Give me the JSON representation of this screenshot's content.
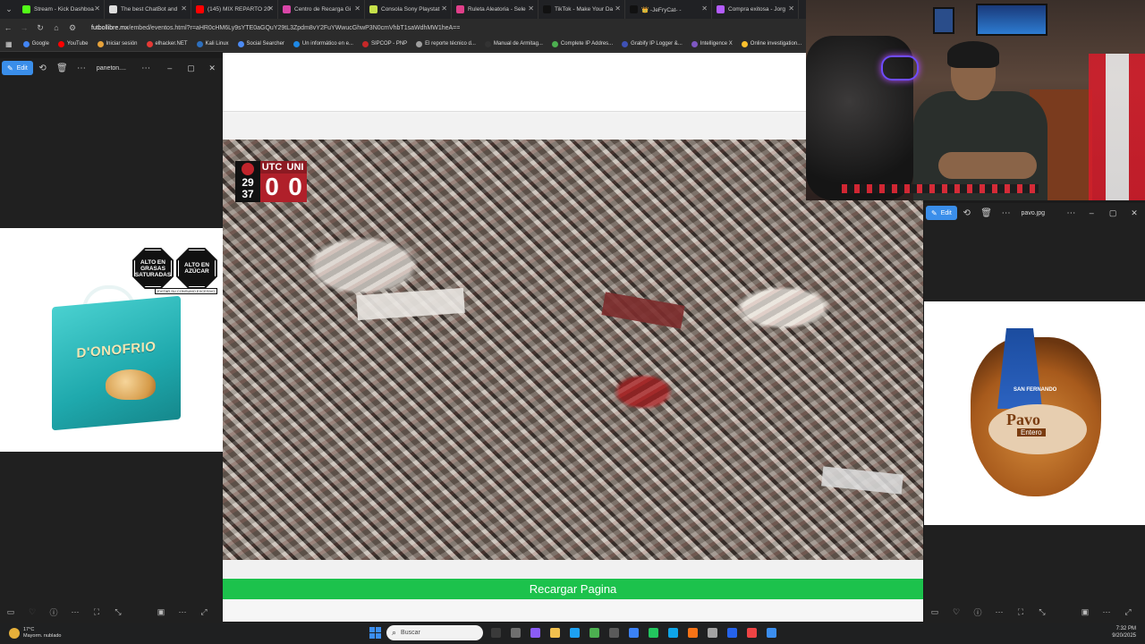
{
  "browser": {
    "tabs": [
      {
        "label": "Stream - Kick Dashboa",
        "color": "#53fc18"
      },
      {
        "label": "The best ChatBot and",
        "color": "#dddddd"
      },
      {
        "label": "(145) MIX REPARTO 20",
        "color": "#ff0000"
      },
      {
        "label": "Centro de Recarga Gi",
        "color": "#d946a8"
      },
      {
        "label": "Consola Sony Playstat",
        "color": "#c6e14a"
      },
      {
        "label": "Ruleta Aleatoria - Sele",
        "color": "#e03f8a"
      },
      {
        "label": "TikTok - Make Your Da",
        "color": "#111111"
      },
      {
        "label": "👑 -JeFryCat- -",
        "color": "#111111"
      },
      {
        "label": "Compra exitosa - Jorg",
        "color": "#b45cff"
      }
    ],
    "url_host": "futbollibre.mx",
    "url_path": "/embed/eventos.html?r=aHR0cHM6Ly9sYTE0aGQuY29tL3Zpdm8vY2FuYWwucGhwP3N0cmVhbT1saWdhMW1heA==",
    "bookmarks": [
      {
        "label": "Google",
        "color": "#4285f4"
      },
      {
        "label": "YouTube",
        "color": "#ff0000"
      },
      {
        "label": "Iniciar sesión",
        "color": "#e6a23a"
      },
      {
        "label": "elhacker.NET",
        "color": "#e53935"
      },
      {
        "label": "Kali Linux",
        "color": "#2d6fbe"
      },
      {
        "label": "Social Searcher",
        "color": "#4c8bf5"
      },
      {
        "label": "Un informático en e...",
        "color": "#1e88e5"
      },
      {
        "label": "SIPCOP - PNP",
        "color": "#c62828"
      },
      {
        "label": "El reporte técnico d...",
        "color": "#9e9e9e"
      },
      {
        "label": "Manual de Armitag...",
        "color": "#333333"
      },
      {
        "label": "Complete IP Addres...",
        "color": "#4caf50"
      },
      {
        "label": "Grabify IP Logger &...",
        "color": "#3f51b5"
      },
      {
        "label": "Intelligence X",
        "color": "#7e57c2"
      },
      {
        "label": "Online investigation...",
        "color": "#fbc02d"
      }
    ]
  },
  "scoreboard": {
    "minute": "29",
    "second": "37",
    "home": "UTC",
    "away": "UNI",
    "home_score": "0",
    "away_score": "0"
  },
  "page": {
    "reload_label": "Recargar Pagina"
  },
  "viewer_left": {
    "edit_label": "Edit",
    "title": "paneton....",
    "warn1": "ALTO EN GRASAS SATURADAS",
    "warn2": "ALTO EN AZÚCAR",
    "warn_note": "EVITAR SU CONSUMO EXCESIVO",
    "product_brand": "D'ONOFRIO"
  },
  "viewer_right": {
    "edit_label": "Edit",
    "title": "pavo.jpg",
    "product_name": "Pavo",
    "product_sub": "Entero",
    "product_brand": "SAN FERNANDO"
  },
  "taskbar": {
    "temp": "17°C",
    "weather": "Mayorm. nublado",
    "search_placeholder": "Buscar",
    "time": "7:32 PM",
    "date": "9/20/2025",
    "weather_badge": "2"
  }
}
